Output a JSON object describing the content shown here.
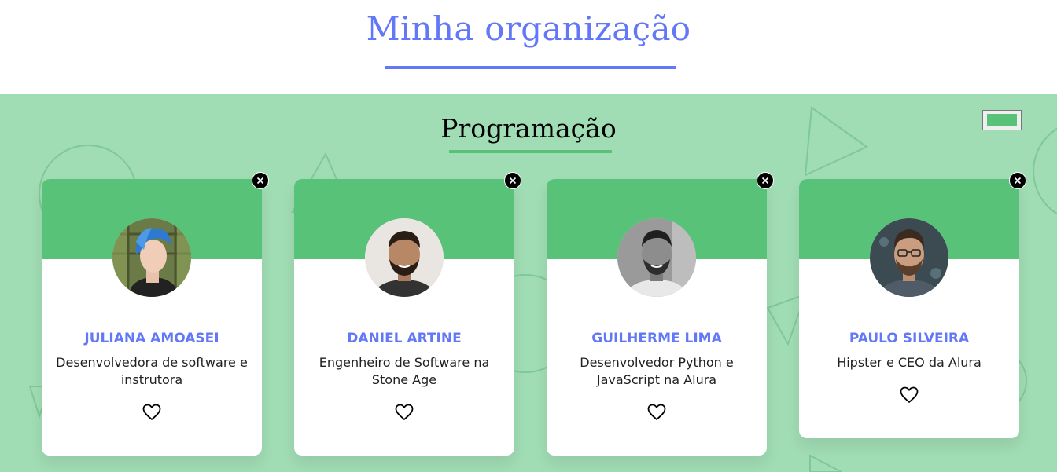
{
  "header": {
    "title": "Minha organização"
  },
  "team": {
    "title": "Programação",
    "primary_color": "#57c278",
    "secondary_color": "#a0dcb4",
    "color_input_value": "#57c278"
  },
  "members": [
    {
      "name": "JULIANA AMOASEI",
      "role": "Desenvolvedora de software e instrutora",
      "favorite": false
    },
    {
      "name": "DANIEL ARTINE",
      "role": "Engenheiro de Software na Stone Age",
      "favorite": false
    },
    {
      "name": "GUILHERME LIMA",
      "role": "Desenvolvedor Python e JavaScript na Alura",
      "favorite": false
    },
    {
      "name": "PAULO SILVEIRA",
      "role": "Hipster e CEO da Alura",
      "favorite": false
    }
  ],
  "colors": {
    "accent": "#6278f7",
    "card_text": "#212121"
  },
  "icons": {
    "delete": "close-circle-icon",
    "favorite": "heart-outline-icon"
  }
}
